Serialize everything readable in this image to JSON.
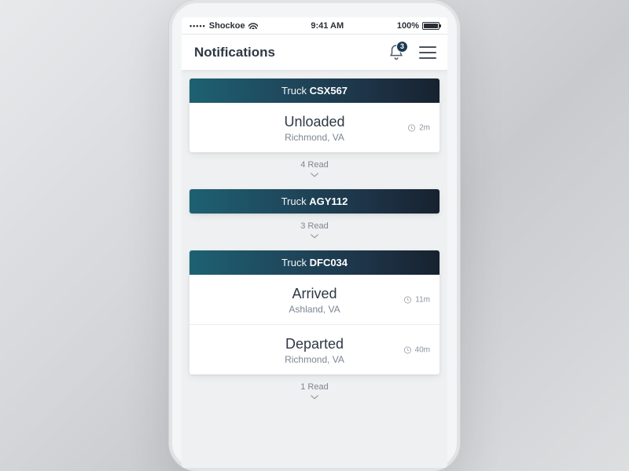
{
  "statusbar": {
    "carrier": "Shockoe",
    "time": "9:41 AM",
    "battery": "100%"
  },
  "header": {
    "title": "Notifications",
    "badge_count": "3"
  },
  "groups": [
    {
      "label": "Truck",
      "id": "CSX567",
      "entries": [
        {
          "status": "Unloaded",
          "location": "Richmond, VA",
          "time": "2m"
        }
      ],
      "read_label": "4 Read"
    },
    {
      "label": "Truck",
      "id": "AGY112",
      "entries": [],
      "read_label": "3 Read"
    },
    {
      "label": "Truck",
      "id": "DFC034",
      "entries": [
        {
          "status": "Arrived",
          "location": "Ashland, VA",
          "time": "11m"
        },
        {
          "status": "Departed",
          "location": "Richmond, VA",
          "time": "40m"
        }
      ],
      "read_label": "1 Read"
    }
  ]
}
